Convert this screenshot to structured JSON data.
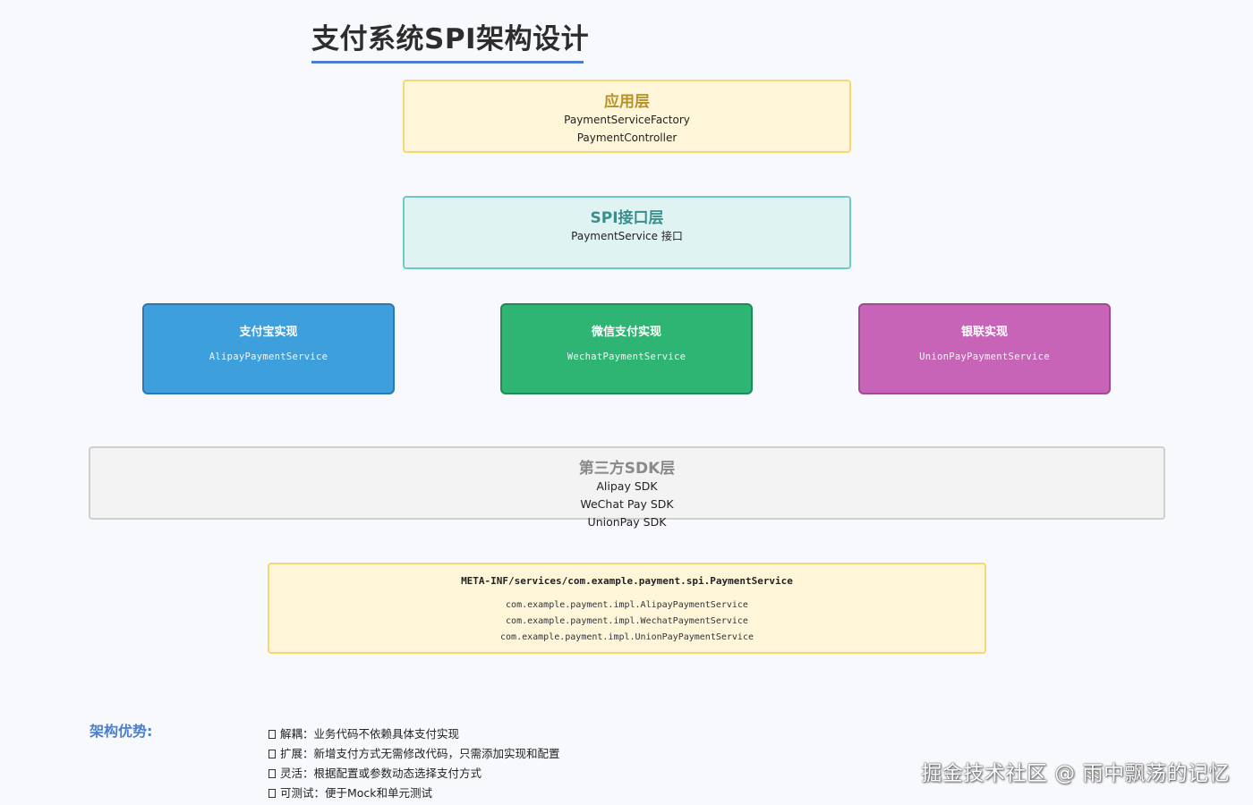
{
  "title": "支付系统SPI架构设计",
  "app_layer": {
    "header": "应用层",
    "lines": [
      "PaymentServiceFactory",
      "PaymentController"
    ]
  },
  "spi_layer": {
    "header": "SPI接口层",
    "lines": [
      "PaymentService 接口"
    ]
  },
  "implementations": [
    {
      "header": "支付宝实现",
      "class_name": "AlipayPaymentService",
      "color": "#3d9fdc"
    },
    {
      "header": "微信支付实现",
      "class_name": "WechatPaymentService",
      "color": "#2eb574"
    },
    {
      "header": "银联实现",
      "class_name": "UnionPayPaymentService",
      "color": "#c764b8"
    }
  ],
  "sdk_layer": {
    "header": "第三方SDK层",
    "lines": [
      "Alipay SDK",
      "WeChat Pay SDK",
      "UnionPay SDK"
    ]
  },
  "meta_inf": {
    "header": "META-INF/services/com.example.payment.spi.PaymentService",
    "lines": [
      "com.example.payment.impl.AlipayPaymentService",
      "com.example.payment.impl.WechatPaymentService",
      "com.example.payment.impl.UnionPayPaymentService"
    ]
  },
  "advantages": {
    "title": "架构优势:",
    "items": [
      "解耦：业务代码不依赖具体支付实现",
      "扩展：新增支付方式无需修改代码，只需添加实现和配置",
      "灵活：根据配置或参数动态选择支付方式",
      "可测试：便于Mock和单元测试"
    ]
  },
  "watermark": "掘金技术社区 @ 雨中飘荡的记忆"
}
